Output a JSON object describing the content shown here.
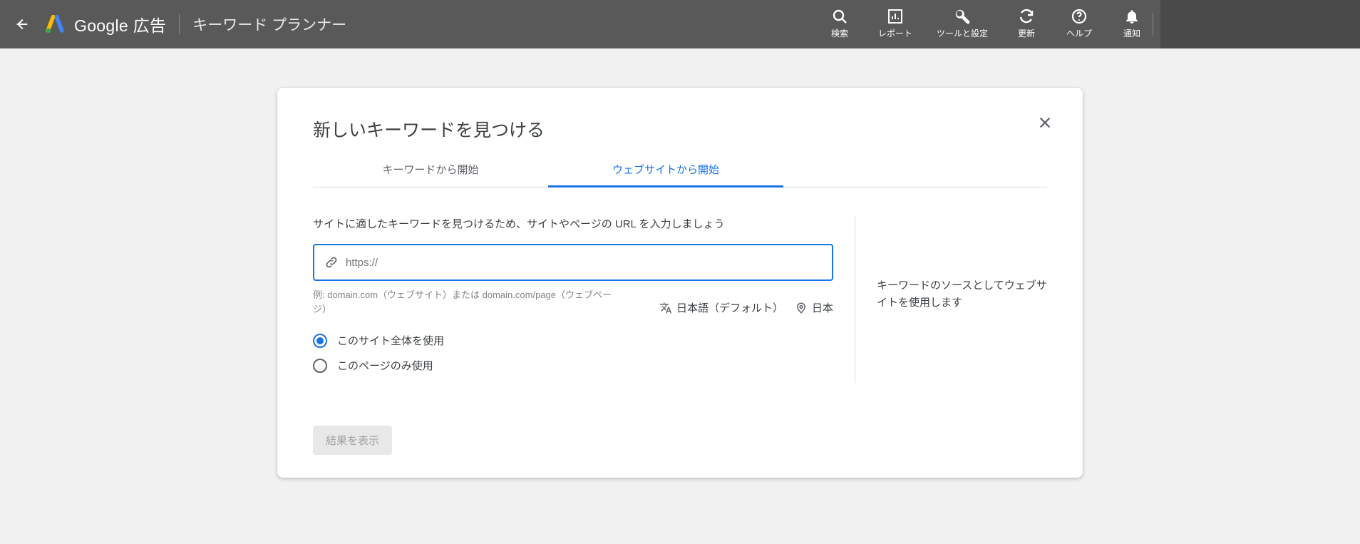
{
  "header": {
    "brand_bold": "Google",
    "brand_rest": " 広告",
    "page_title": "キーワード プランナー",
    "nav": {
      "search": "検索",
      "report": "レポート",
      "tools": "ツールと設定",
      "refresh": "更新",
      "help": "ヘルプ",
      "notify": "通知"
    }
  },
  "card": {
    "title": "新しいキーワードを見つける",
    "tabs": {
      "keywords": "キーワードから開始",
      "website": "ウェブサイトから開始"
    },
    "instruction": "サイトに適したキーワードを見つけるため、サイトやページの URL を入力しましょう",
    "url_placeholder": "https://",
    "example": "例: domain.com（ウェブサイト）または domain.com/page（ウェブページ）",
    "language": "日本語（デフォルト）",
    "location": "日本",
    "radio_full": "このサイト全体を使用",
    "radio_page": "このページのみ使用",
    "right_note": "キーワードのソースとしてウェブサイトを使用します",
    "submit": "結果を表示"
  }
}
